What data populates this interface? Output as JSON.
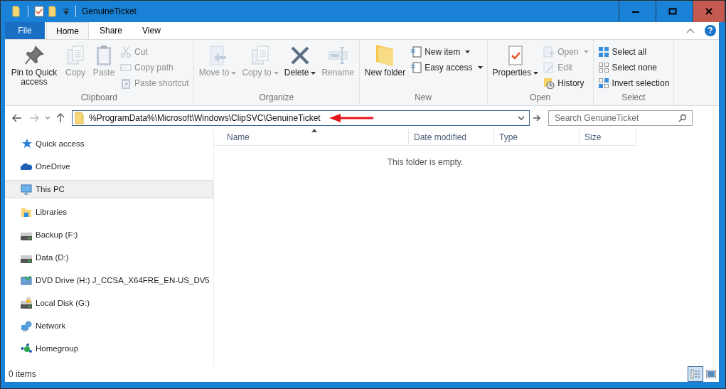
{
  "window": {
    "title": "GenuineTicket"
  },
  "help_button": "?",
  "tabs": [
    {
      "label": "File",
      "kind": "file",
      "selected": false
    },
    {
      "label": "Home",
      "kind": "tab",
      "selected": true
    },
    {
      "label": "Share",
      "kind": "tab",
      "selected": false
    },
    {
      "label": "View",
      "kind": "tab",
      "selected": false
    }
  ],
  "ribbon": {
    "groups": [
      {
        "label": "Clipboard",
        "large": [
          {
            "label": "Pin to Quick access",
            "disabled": false,
            "dropdown": false
          },
          {
            "label": "Copy",
            "disabled": true,
            "dropdown": false
          },
          {
            "label": "Paste",
            "disabled": true,
            "dropdown": false
          }
        ],
        "small": [
          {
            "label": "Cut",
            "disabled": true,
            "dropdown": false
          },
          {
            "label": "Copy path",
            "disabled": true,
            "dropdown": false
          },
          {
            "label": "Paste shortcut",
            "disabled": true,
            "dropdown": false
          }
        ]
      },
      {
        "label": "Organize",
        "large": [
          {
            "label": "Move to",
            "disabled": true,
            "dropdown": true
          },
          {
            "label": "Copy to",
            "disabled": true,
            "dropdown": true
          },
          {
            "label": "Delete",
            "disabled": false,
            "dropdown": true
          },
          {
            "label": "Rename",
            "disabled": true,
            "dropdown": false
          }
        ]
      },
      {
        "label": "New",
        "large": [
          {
            "label": "New folder",
            "disabled": false,
            "dropdown": false
          }
        ],
        "small": [
          {
            "label": "New item",
            "disabled": false,
            "dropdown": true
          },
          {
            "label": "Easy access",
            "disabled": false,
            "dropdown": true
          }
        ]
      },
      {
        "label": "Open",
        "large": [
          {
            "label": "Properties",
            "disabled": false,
            "dropdown": true
          }
        ],
        "small": [
          {
            "label": "Open",
            "disabled": true,
            "dropdown": true
          },
          {
            "label": "Edit",
            "disabled": true,
            "dropdown": false
          },
          {
            "label": "History",
            "disabled": false,
            "dropdown": false
          }
        ]
      },
      {
        "label": "Select",
        "small": [
          {
            "label": "Select all",
            "disabled": false,
            "dropdown": false
          },
          {
            "label": "Select none",
            "disabled": false,
            "dropdown": false
          },
          {
            "label": "Invert selection",
            "disabled": false,
            "dropdown": false
          }
        ]
      }
    ]
  },
  "address_bar": {
    "value": "%ProgramData%\\Microsoft\\Windows\\ClipSVC\\GenuineTicket"
  },
  "search": {
    "placeholder": "Search GenuineTicket"
  },
  "sidebar": {
    "items": [
      {
        "label": "Quick access",
        "kind": "star",
        "selected": false
      },
      {
        "label": "OneDrive",
        "kind": "cloud",
        "selected": false
      },
      {
        "label": "This PC",
        "kind": "pc",
        "selected": true
      },
      {
        "label": "Libraries",
        "kind": "library",
        "selected": false
      },
      {
        "label": "Backup (F:)",
        "kind": "drive",
        "selected": false
      },
      {
        "label": "Data (D:)",
        "kind": "drive",
        "selected": false
      },
      {
        "label": "DVD Drive (H:) J_CCSA_X64FRE_EN-US_DV5",
        "kind": "dvd",
        "selected": false
      },
      {
        "label": "Local Disk (G:)",
        "kind": "locked-drive",
        "selected": false
      },
      {
        "label": "Network",
        "kind": "network",
        "selected": false
      },
      {
        "label": "Homegroup",
        "kind": "homegroup",
        "selected": false
      }
    ]
  },
  "table": {
    "columns": [
      {
        "label": "Name",
        "sorted": true
      },
      {
        "label": "Date modified",
        "sorted": false
      },
      {
        "label": "Type",
        "sorted": false
      },
      {
        "label": "Size",
        "sorted": false
      }
    ],
    "empty_message": "This folder is empty."
  },
  "status_bar": {
    "count": "0 items",
    "views": [
      {
        "kind": "details",
        "selected": true
      },
      {
        "kind": "thumbnails",
        "selected": false
      }
    ]
  }
}
